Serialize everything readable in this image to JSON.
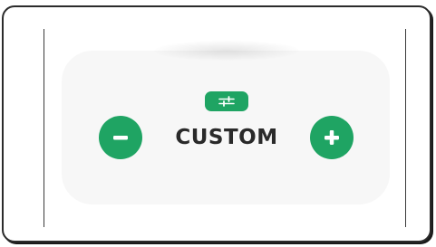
{
  "control": {
    "mode_label": "CUSTOM"
  },
  "icons": {
    "settings": "sliders-icon",
    "decrease": "minus-icon",
    "increase": "plus-icon"
  },
  "colors": {
    "accent": "#1fa463",
    "card_background": "#f7f7f7",
    "label_text": "#2a2a2a"
  }
}
